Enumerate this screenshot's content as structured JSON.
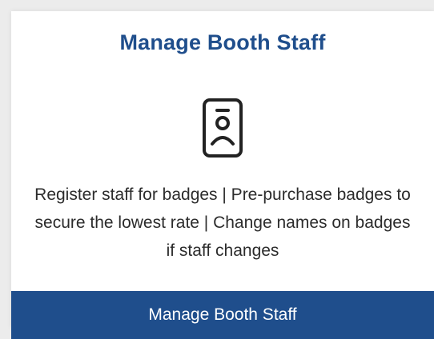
{
  "card": {
    "title": "Manage Booth Staff",
    "icon": "id-badge-icon",
    "description": "Register staff for badges | Pre-purchase badges to secure the lowest rate | Change names on badges if staff changes",
    "button_label": "Manage Booth Staff"
  },
  "colors": {
    "accent": "#1f4e8c",
    "text": "#2c2c2c",
    "background": "#ffffff"
  }
}
